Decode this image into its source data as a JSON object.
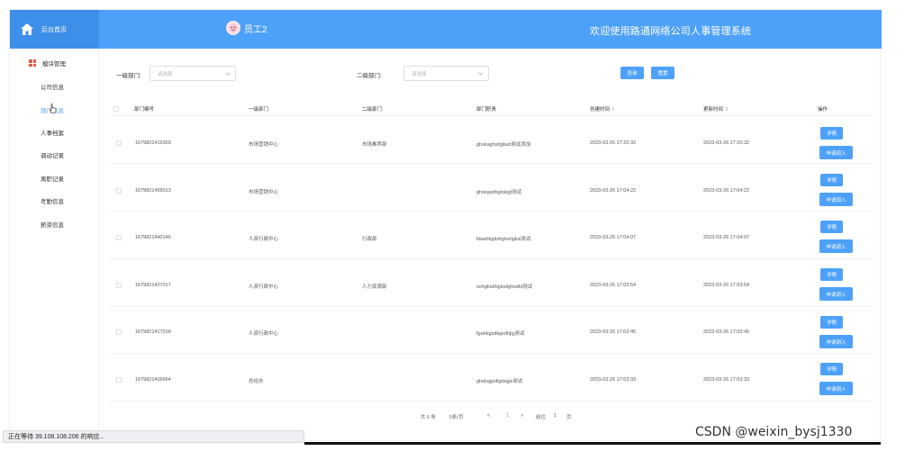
{
  "header": {
    "home_label": "后台首页",
    "user_name": "员工2",
    "site_title": "欢迎使用路通网络公司人事管理系统"
  },
  "sidebar": {
    "module_title": "模块管理",
    "items": [
      {
        "label": "公司信息"
      },
      {
        "label": "部门信息"
      },
      {
        "label": "人事档案"
      },
      {
        "label": "调动记录"
      },
      {
        "label": "离职记录"
      },
      {
        "label": "考勤信息"
      },
      {
        "label": "薪资信息"
      }
    ]
  },
  "filters": {
    "dept1_label": "一级部门:",
    "dept1_placeholder": "请选择",
    "dept2_label": "二级部门:",
    "dept2_placeholder": "请选择",
    "query_button": "查询",
    "reset_button": "重置"
  },
  "table": {
    "headers": [
      "部门编号",
      "一级部门",
      "二级部门",
      "部门职责",
      "创建时间",
      "更新时间",
      "操作"
    ],
    "sort_icon": "⇕",
    "detail_button": "详情",
    "apply_button": "申请调入",
    "rows": [
      {
        "id": "1679822419303",
        "dept1": "市场营销中心",
        "dept2": "市场推荐部",
        "duty": "ghskaghsdgksd测试添加",
        "created": "2023-03-26 17:20:32",
        "updated": "2023-03-26 17:20:32"
      },
      {
        "id": "1679821455013",
        "dept1": "市场营销中心",
        "dept2": "",
        "duty": "ghskgsdhgkskgl测试",
        "created": "2023-03-26 17:04:22",
        "updated": "2023-03-26 17:04:22"
      },
      {
        "id": "1679821440146",
        "dept1": "人资行政中心",
        "dept2": "行政部",
        "duty": "fdashkgdshgkshgksl测试",
        "created": "2023-03-26 17:04:07",
        "updated": "2023-03-26 17:04:07"
      },
      {
        "id": "1679821427017",
        "dept1": "人资行政中心",
        "dept2": "人力资源部",
        "duty": "sehgksdhgksdghsdkl测试",
        "created": "2023-03-26 17:03:54",
        "updated": "2023-03-26 17:03:54"
      },
      {
        "id": "1679821417018",
        "dept1": "人资行政中心",
        "dept2": "",
        "duty": "fgahkgsdkgsdhjlg测试",
        "created": "2023-03-26 17:03:45",
        "updated": "2023-03-26 17:03:45"
      },
      {
        "id": "1679821406664",
        "dept1": "总经办",
        "dept2": "",
        "duty": "ghalsgjsdlgdsgjs测试",
        "created": "2023-03-26 17:03:33",
        "updated": "2023-03-26 17:03:33"
      }
    ]
  },
  "pagination": {
    "total": "共 6 条",
    "page_size": "5条/页",
    "prev": "<",
    "current_page": "1",
    "next": ">",
    "goto_label": "前往",
    "goto_value": "1",
    "page_suffix": "页"
  },
  "status_bar": {
    "text": "正在等待 39.108.108.206 的响应..."
  },
  "watermark": {
    "text": "CSDN @weixin_bysj1330"
  },
  "colors": {
    "primary": "#4ea1f8",
    "header_dark": "#3d8fe9",
    "module_icon": "#e25c4b"
  }
}
